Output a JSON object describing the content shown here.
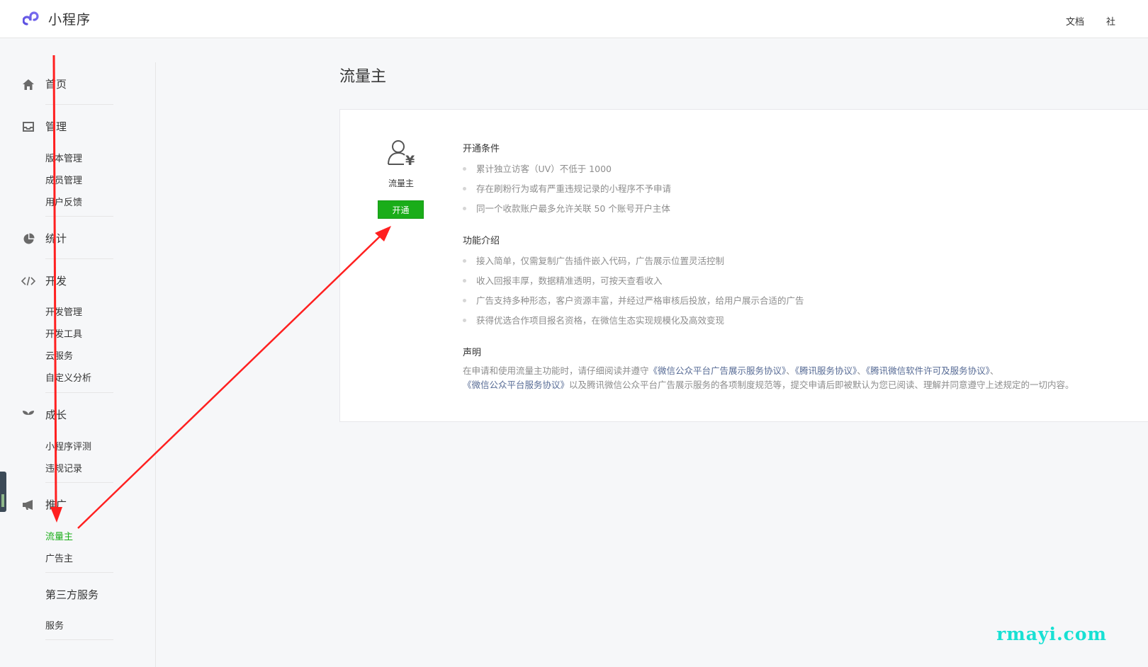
{
  "app": {
    "logo_text": "小程序",
    "top_links": [
      "文档",
      "社"
    ]
  },
  "sidebar": {
    "sections": [
      {
        "label": "首页",
        "icon": "home-icon",
        "items": []
      },
      {
        "label": "管理",
        "icon": "inbox-icon",
        "items": [
          "版本管理",
          "成员管理",
          "用户反馈"
        ]
      },
      {
        "label": "统计",
        "icon": "pie-chart-icon",
        "items": []
      },
      {
        "label": "开发",
        "icon": "code-icon",
        "items": [
          "开发管理",
          "开发工具",
          "云服务",
          "自定义分析"
        ]
      },
      {
        "label": "成长",
        "icon": "sprout-icon",
        "items": [
          "小程序评测",
          "违规记录"
        ]
      },
      {
        "label": "推广",
        "icon": "megaphone-icon",
        "items": [
          "流量主",
          "广告主"
        ]
      },
      {
        "label": "第三方服务",
        "icon": "",
        "items": [
          "服务"
        ]
      }
    ],
    "active_item": "流量主"
  },
  "main": {
    "title": "流量主",
    "feature": {
      "icon": "user-yen-icon",
      "name": "流量主",
      "button_label": "开通"
    },
    "conditions": {
      "title": "开通条件",
      "items": [
        "累计独立访客（UV）不低于 1000",
        "存在刷粉行为或有严重违规记录的小程序不予申请",
        "同一个收款账户最多允许关联 50 个账号开户主体"
      ]
    },
    "intro": {
      "title": "功能介绍",
      "items": [
        "接入简单，仅需复制广告插件嵌入代码，广告展示位置灵活控制",
        "收入回报丰厚，数据精准透明，可按天查看收入",
        "广告支持多种形态，客户资源丰富，并经过严格审核后投放，给用户展示合适的广告",
        "获得优选合作项目报名资格，在微信生态实现规模化及高效变现"
      ]
    },
    "declaration": {
      "title": "声明",
      "prefix": "在申请和使用流量主功能时，请仔细阅读并遵守",
      "link1": "《微信公众平台广告展示服务协议》",
      "sep1": "、",
      "link2": "《腾讯服务协议》",
      "sep2": "、",
      "link3": "《腾讯微信软件许可及服务协议》",
      "sep3": "、",
      "link4": "《微信公众平台服务协议》",
      "suffix": "以及腾讯微信公众平台广告展示服务的各项制度规范等，提交申请后即被默认为您已阅读、理解并同意遵守上述规定的一切内容。"
    }
  },
  "colors": {
    "accent_green": "#1aad19",
    "link_blue": "#576b95",
    "annotation_red": "#ff2020",
    "watermark_cyan": "#18e0d3"
  },
  "watermark": "rmayi.com"
}
